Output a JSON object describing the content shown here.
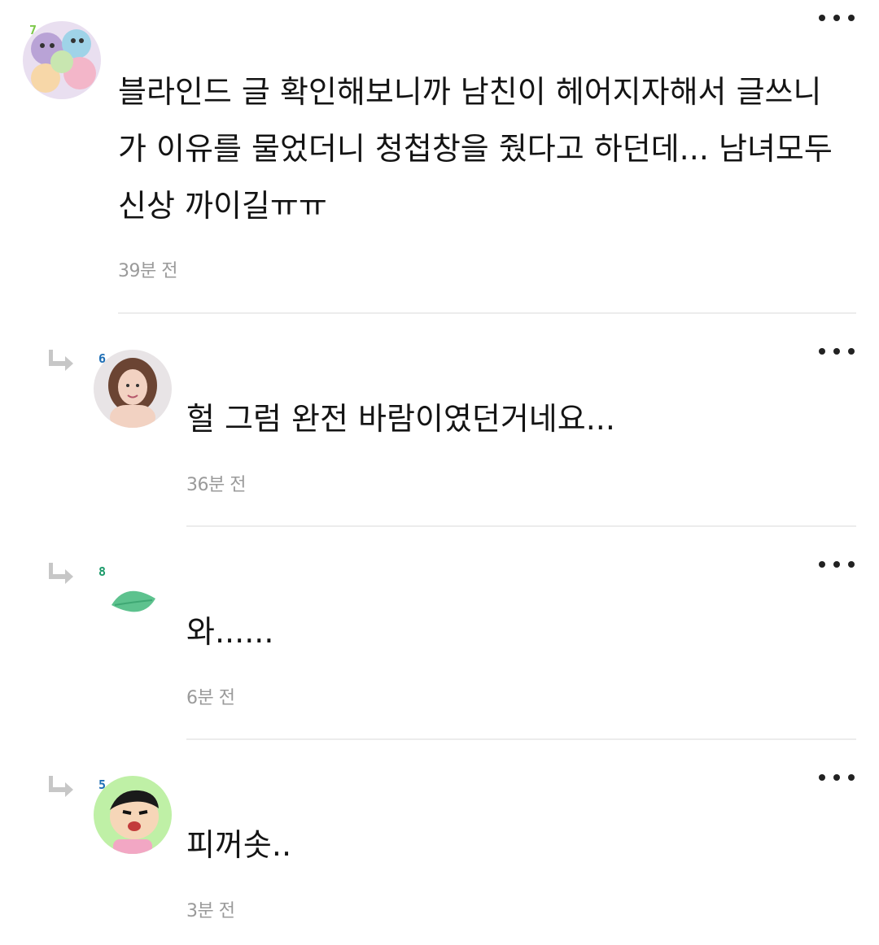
{
  "comments": [
    {
      "level": "7",
      "text": "블라인드 글 확인해보니까 남친이 헤어지자해서 글쓰니가 이유를 물었더니 청첩창을 줬다고 하던데... 남녀모두 신상 까이길ㅠㅠ",
      "time": "39분 전",
      "avatar": "plush-toys-avatar",
      "accent": "#7dc84a"
    },
    {
      "level": "6",
      "text": "헐 그럼 완전 바람이였던거네요...",
      "time": "36분 전",
      "avatar": "woman-photo-avatar",
      "accent": "#1f6fb6"
    },
    {
      "level": "8",
      "text": "와......",
      "time": "6분 전",
      "avatar": "green-leaf-avatar",
      "accent": "#1c9a6a"
    },
    {
      "level": "5",
      "text": "피꺼솟..",
      "time": "3분 전",
      "avatar": "cartoon-boy-avatar",
      "accent": "#1f6fb6"
    }
  ],
  "icons": {
    "more": "more-options-icon",
    "reply": "reply-arrow-icon"
  }
}
